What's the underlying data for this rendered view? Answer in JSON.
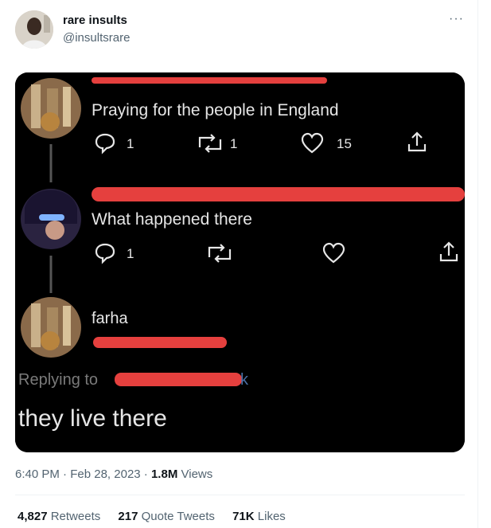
{
  "tweet": {
    "author_name": "rare insults",
    "author_handle": "@insultsrare",
    "more_label": "···",
    "time": "6:40 PM",
    "separator": "·",
    "date": "Feb 28, 2023",
    "views_count": "1.8M",
    "views_label": "Views",
    "retweets_count": "4,827",
    "retweets_label": "Retweets",
    "quotes_count": "217",
    "quotes_label": "Quote Tweets",
    "likes_count": "71K",
    "likes_label": "Likes"
  },
  "screenshot": {
    "post1": {
      "text": "Praying for the people in England",
      "replies": "1",
      "retweets": "1",
      "likes": "15"
    },
    "post2": {
      "text": "What happened there",
      "replies": "1"
    },
    "post3": {
      "name": "farha",
      "replying_prefix": "Replying to",
      "replying_suffix": "k",
      "text": "they live there"
    }
  },
  "colors": {
    "accent": "#1d9bf0",
    "redaction": "#e5403e",
    "muted": "#536471"
  },
  "icons": [
    "more-icon",
    "reply-icon",
    "retweet-icon",
    "like-icon",
    "share-icon"
  ]
}
